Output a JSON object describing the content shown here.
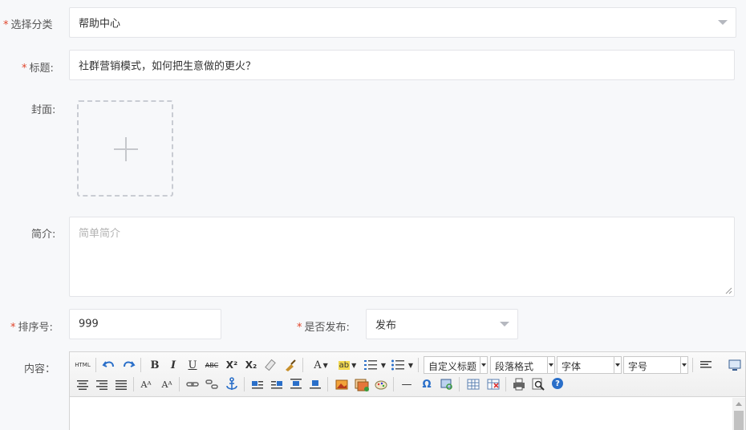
{
  "form": {
    "category": {
      "label": "选择分类",
      "value": "帮助中心"
    },
    "title": {
      "label": "标题:",
      "value": "社群营销模式，如何把生意做的更火？"
    },
    "cover": {
      "label": "封面:"
    },
    "intro": {
      "label": "简介:",
      "placeholder": "简单简介"
    },
    "sort": {
      "label": "排序号:",
      "value": "999"
    },
    "publish": {
      "label": "是否发布:",
      "value": "发布"
    },
    "content": {
      "label": "内容："
    },
    "required_mark": "*"
  },
  "editor": {
    "html_label": "HTML",
    "custom_title": "自定义标题",
    "paragraph_format": "段落格式",
    "font_family": "字体",
    "font_size": "字号",
    "bold": "B",
    "italic": "I",
    "underline": "U",
    "strike": "ABC",
    "superscript": "X²",
    "subscript": "X₂",
    "font_color": "A",
    "omega": "Ω",
    "hr": "—",
    "help": "?"
  },
  "colors": {
    "accent_required": "#e0452b",
    "border": "#e3e4e8",
    "background": "#f7f8fa"
  }
}
